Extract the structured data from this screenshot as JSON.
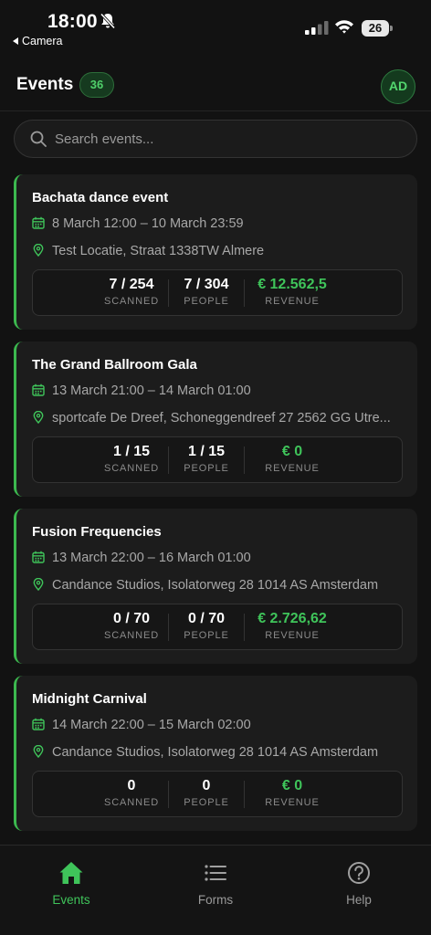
{
  "status_bar": {
    "time": "18:00",
    "back_app": "Camera",
    "battery": "26",
    "icons": [
      "bell-slash-icon",
      "signal-icon",
      "wifi-icon",
      "battery-icon"
    ]
  },
  "header": {
    "title": "Events",
    "count": "36",
    "avatar_initials": "AD"
  },
  "search": {
    "placeholder": "Search events..."
  },
  "colors": {
    "accent": "#3fc45a",
    "background": "#121212",
    "card": "#1c1c1c"
  },
  "events": [
    {
      "title": "Bachata dance event",
      "date": "8 March 12:00 – 10 March 23:59",
      "location": "Test Locatie, Straat 1338TW Almere",
      "scanned": "7 / 254",
      "people": "7 / 304",
      "revenue": "€ 12.562,5"
    },
    {
      "title": "The Grand Ballroom Gala",
      "date": "13 March 21:00 – 14 March 01:00",
      "location": "sportcafe De Dreef, Schoneggendreef 27 2562 GG Utre...",
      "scanned": "1 / 15",
      "people": "1 / 15",
      "revenue": "€ 0"
    },
    {
      "title": "Fusion Frequencies",
      "date": "13 March 22:00 – 16 March 01:00",
      "location": "Candance Studios, Isolatorweg 28 1014 AS  Amsterdam",
      "scanned": "0 / 70",
      "people": "0 / 70",
      "revenue": "€ 2.726,62"
    },
    {
      "title": "Midnight Carnival",
      "date": "14 March 22:00 – 15 March 02:00",
      "location": "Candance Studios, Isolatorweg 28 1014 AS  Amsterdam",
      "scanned": "0",
      "people": "0",
      "revenue": "€ 0"
    }
  ],
  "stat_labels": {
    "scanned": "SCANNED",
    "people": "PEOPLE",
    "revenue": "REVENUE"
  },
  "tabbar": {
    "items": [
      {
        "label": "Events",
        "icon": "home-icon",
        "active": true
      },
      {
        "label": "Forms",
        "icon": "list-icon",
        "active": false
      },
      {
        "label": "Help",
        "icon": "help-icon",
        "active": false
      }
    ]
  }
}
